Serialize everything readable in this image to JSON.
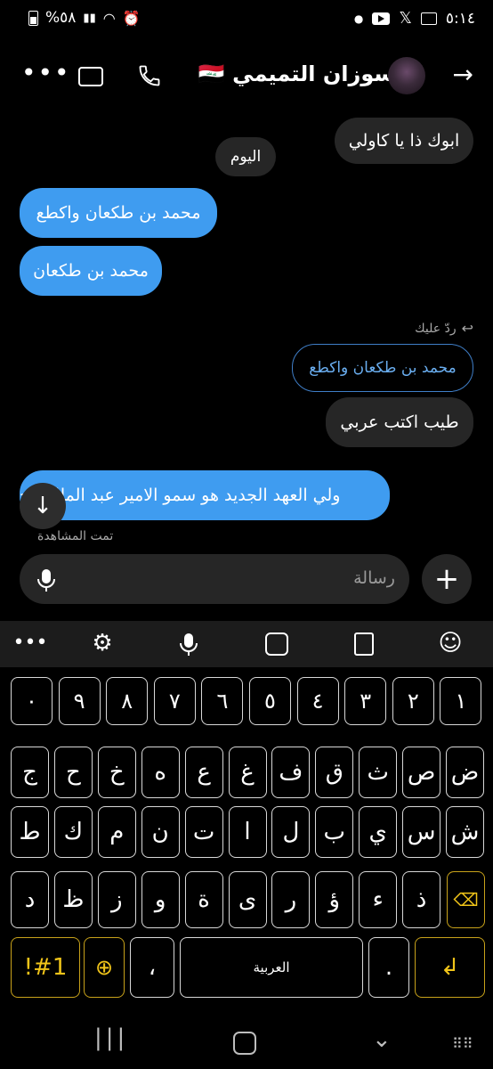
{
  "status_bar": {
    "battery_text": "%٥٨",
    "time": "٥:١٤"
  },
  "header": {
    "contact_name": "سوزان التميمي 🇮🇶"
  },
  "messages": {
    "m1": "ابوك ذا يا كاولي",
    "day": "اليوم",
    "m2": "محمد   بن طكعان واكطع",
    "m3": "محمد بن طكعان",
    "reply_label": "ردّ عليك",
    "reply_quote": "محمد   بن طكعان واكطع",
    "m4": "طيب اكتب عربي",
    "m5": "ولي العهد الجديد هو سمو الامير عبد الملك الح",
    "seen": "تمت المشاهدة"
  },
  "composer": {
    "placeholder": "رسالة"
  },
  "keyboard": {
    "row0": [
      "١",
      "٢",
      "٣",
      "٤",
      "٥",
      "٦",
      "٧",
      "٨",
      "٩",
      "٠"
    ],
    "row1": [
      "ض",
      "ص",
      "ث",
      "ق",
      "ف",
      "غ",
      "ع",
      "ه",
      "خ",
      "ح",
      "ج"
    ],
    "row2": [
      "ش",
      "س",
      "ي",
      "ب",
      "ل",
      "ا",
      "ت",
      "ن",
      "م",
      "ك",
      "ط"
    ],
    "row3": [
      "ذ",
      "ء",
      "ؤ",
      "ر",
      "ى",
      "ة",
      "و",
      "ز",
      "ظ",
      "د"
    ],
    "symbols": "!#1",
    "comma": "،",
    "space": "العربية",
    "period": "."
  },
  "colors": {
    "accent_blue": "#3f9cf0",
    "bubble_gray": "#262626",
    "fn_yellow": "#f0c419"
  }
}
